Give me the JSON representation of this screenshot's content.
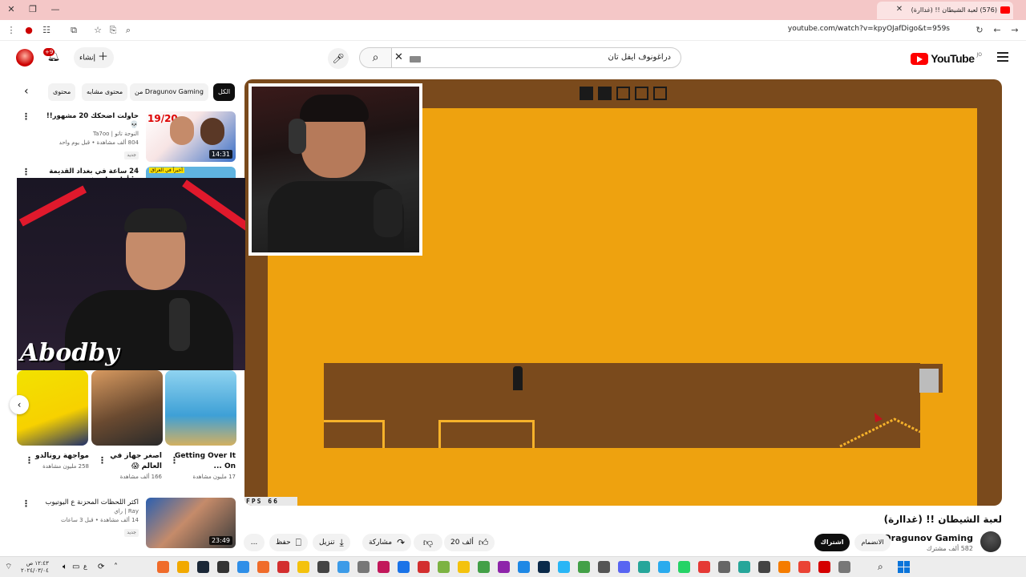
{
  "browser": {
    "tab_title": "(576) لعبة الشيطان !! (غداارة)",
    "url": "youtube.com/watch?v=kpyOJafDigo&t=959s"
  },
  "header": {
    "logo_text": "YouTube",
    "logo_region": "JO",
    "search_value": "دراغونوف ايفل تان",
    "create_label": "إنشاء",
    "notif_count": "+9"
  },
  "player": {
    "fps_label": "FPS 66",
    "progress_boxes": [
      true,
      true,
      false,
      false,
      false
    ]
  },
  "video": {
    "title": "لعبة الشيطان !! (غداارة)",
    "channel": "Dragunov Gaming",
    "subs": "582 ألف مشترك",
    "join_label": "الانضمام",
    "subscribe_label": "اشتراك",
    "like_count": "20 ألف",
    "share_label": "مشاركة",
    "download_label": "تنزيل",
    "save_label": "حفظ",
    "more_label": "..."
  },
  "chips": {
    "all": "الكل",
    "from": "من Dragunov Gaming",
    "related": "محتوى مشابه",
    "more": "محتوى"
  },
  "sidebar": {
    "items": [
      {
        "title": "حاولت اضحكك 20 مشهور!! 💀",
        "channel": "النوجة تاتو | Ta7oo",
        "meta": "804 ألف مشاهدة • قبل يوم واحد",
        "badge": "جديد",
        "duration": "14:31",
        "thumb_label": "19/20"
      },
      {
        "title": "24 ساعة في بغداد القديمة iq أول زيارة في",
        "thumb_label": "أخيراً في العراق"
      },
      {
        "title": "اكثر اللحظات المحزنة ع اليوتيوب",
        "channel": "Ray | راي",
        "meta": "14 ألف مشاهدة • قبل 3 ساعات",
        "badge": "جديد",
        "duration": "23:49"
      }
    ],
    "webcam_brand": "Abodby",
    "shorts": [
      {
        "title": "Getting Over It On ...",
        "views": "17 مليون مشاهدة"
      },
      {
        "title": "اصغر جهاز في العالم 😱",
        "views": "166 ألف مشاهدة"
      },
      {
        "title": "مواجهة رونالدو",
        "views": "258 مليون مشاهدة"
      }
    ]
  },
  "taskbar": {
    "time": "١٢:٤٣ ص",
    "date": "٢٠٢٤/٠٣/٠٤",
    "lang": "ع"
  },
  "colors": {
    "accent": "#ff0000",
    "game_bg": "#eea20f",
    "game_wall": "#7a4a1c",
    "titlebar": "#f4c7c7"
  }
}
